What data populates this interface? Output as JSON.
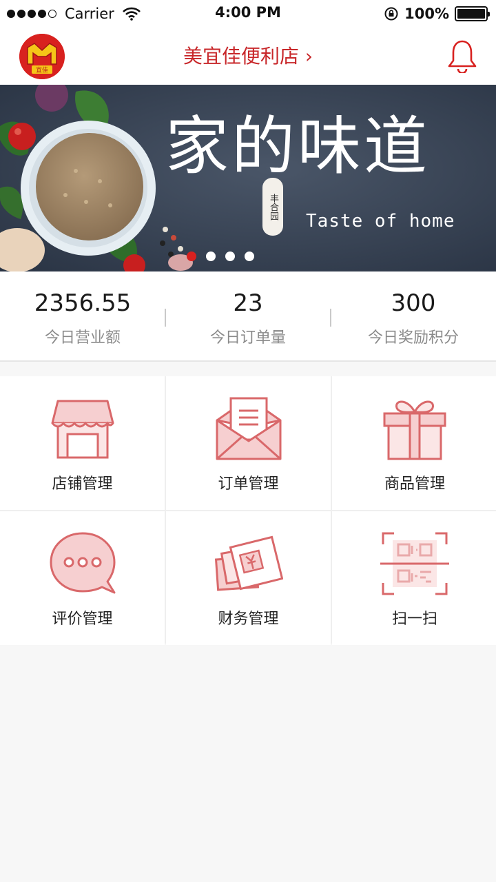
{
  "status_bar": {
    "carrier": "Carrier",
    "time": "4:00 PM",
    "battery": "100%"
  },
  "header": {
    "store_name": "美宜佳便利店 ›",
    "logo_text": "宜佳"
  },
  "banner": {
    "title": "家的味道",
    "subtitle": "Taste of home",
    "brand": "丰合园",
    "slide_count": 4,
    "active_slide": 1
  },
  "stats": [
    {
      "value": "2356.55",
      "label": "今日营业额"
    },
    {
      "value": "23",
      "label": "今日订单量"
    },
    {
      "value": "300",
      "label": "今日奖励积分"
    }
  ],
  "menu": [
    {
      "label": "店铺管理",
      "icon": "shop-icon"
    },
    {
      "label": "订单管理",
      "icon": "order-envelope-icon"
    },
    {
      "label": "商品管理",
      "icon": "gift-icon"
    },
    {
      "label": "评价管理",
      "icon": "comment-bubble-icon"
    },
    {
      "label": "财务管理",
      "icon": "money-cards-icon"
    },
    {
      "label": "扫一扫",
      "icon": "qr-scan-icon"
    }
  ],
  "colors": {
    "accent": "#d8211f",
    "icon_stroke": "#d9686a",
    "icon_fill": "#f6cfd0"
  }
}
